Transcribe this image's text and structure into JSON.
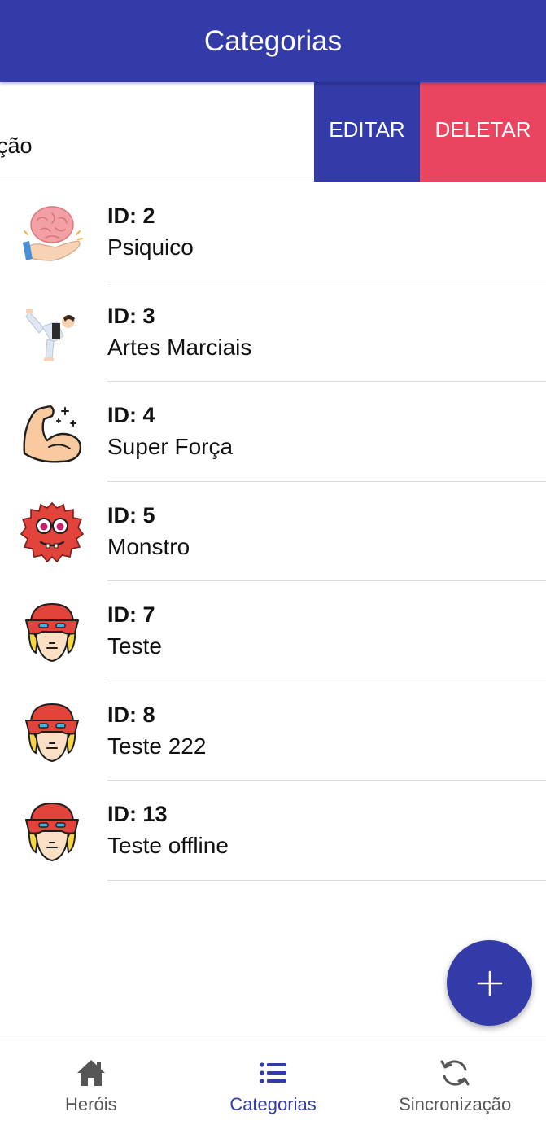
{
  "header": {
    "title": "Categorias"
  },
  "swiped_row": {
    "partial_text": "ção",
    "edit_label": "EDITAR",
    "delete_label": "DELETAR"
  },
  "categories": [
    {
      "id_label": "ID: 2",
      "name": "Psiquico",
      "icon": "brain-hand-icon"
    },
    {
      "id_label": "ID: 3",
      "name": "Artes Marciais",
      "icon": "martial-artist-icon"
    },
    {
      "id_label": "ID: 4",
      "name": "Super Força",
      "icon": "flexed-arm-icon"
    },
    {
      "id_label": "ID: 5",
      "name": "Monstro",
      "icon": "monster-icon"
    },
    {
      "id_label": "ID: 7",
      "name": "Teste",
      "icon": "hero-mask-icon"
    },
    {
      "id_label": "ID: 8",
      "name": "Teste 222",
      "icon": "hero-mask-icon"
    },
    {
      "id_label": "ID: 13",
      "name": "Teste offline",
      "icon": "hero-mask-icon"
    }
  ],
  "fab": {
    "icon": "plus-icon"
  },
  "bottom_nav": [
    {
      "label": "Heróis",
      "icon": "home-icon",
      "active": false
    },
    {
      "label": "Categorias",
      "icon": "list-icon",
      "active": true
    },
    {
      "label": "Sincronização",
      "icon": "sync-icon",
      "active": false
    }
  ],
  "colors": {
    "primary": "#333ba8",
    "danger": "#ea4560",
    "nav_inactive": "#555555"
  }
}
